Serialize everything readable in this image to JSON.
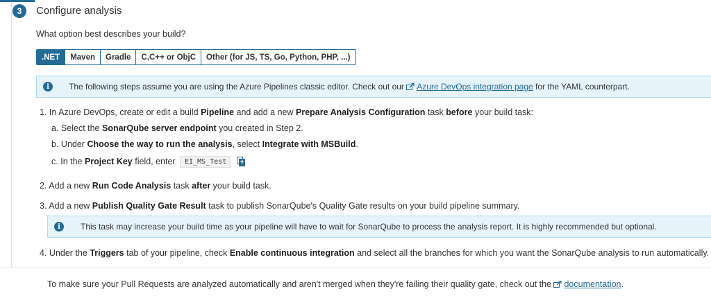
{
  "step": {
    "number": "3",
    "title": "Configure analysis"
  },
  "question": "What option best describes your build?",
  "build_options": [
    ".NET",
    "Maven",
    "Gradle",
    "C,C++ or ObjC",
    "Other (for JS, TS, Go, Python, PHP, ...)"
  ],
  "selected_option": ".NET",
  "info1": {
    "text_before": "The following steps assume you are using the Azure Pipelines classic editor. Check out our ",
    "link": "Azure DevOps integration page",
    "text_after": " for the YAML counterpart."
  },
  "steps": {
    "s1": {
      "n": "1.",
      "t1": "In Azure DevOps, create or edit a build ",
      "b1": "Pipeline",
      "t2": " and add a new ",
      "b2": "Prepare Analysis Configuration",
      "t3": " task ",
      "b3": "before",
      "t4": " your build task:"
    },
    "s1a": {
      "n": "a.",
      "t1": "Select the ",
      "b1": "SonarQube server endpoint",
      "t2": " you created in Step 2."
    },
    "s1b": {
      "n": "b.",
      "t1": "Under ",
      "b1": "Choose the way to run the analysis",
      "t2": ", select ",
      "b2": "Integrate with MSBuild",
      "t3": "."
    },
    "s1c": {
      "n": "c.",
      "t1": "In the ",
      "b1": "Project Key",
      "t2": " field, enter ",
      "code": "EI_MS_Test"
    },
    "s2": {
      "n": "2.",
      "t1": "Add a new ",
      "b1": "Run Code Analysis",
      "t2": " task ",
      "b2": "after",
      "t3": " your build task."
    },
    "s3": {
      "n": "3.",
      "t1": "Add a new ",
      "b1": "Publish Quality Gate Result",
      "t2": " task to publish SonarQube's Quality Gate results on your build pipeline summary."
    },
    "s4": {
      "n": "4.",
      "t1": "Under the ",
      "b1": "Triggers",
      "t2": " tab of your pipeline, check ",
      "b2": "Enable continuous integration",
      "t3": " and select all the branches for which you want the SonarQube analysis to run automatically."
    }
  },
  "info2": {
    "text": "This task may increase your build time as your pipeline will have to wait for SonarQube to process the analysis report. It is highly recommended but optional."
  },
  "footer": {
    "text_before": "To make sure your Pull Requests are analyzed automatically and aren't merged when they're failing their quality gate, check out the ",
    "link": "documentation",
    "text_after": "."
  },
  "icons": {
    "info": "info-icon",
    "external": "external-link-icon",
    "copy": "copy-icon"
  },
  "colors": {
    "accent": "#236a97",
    "info_bg": "#e6f3fb",
    "info_border": "#b3d9ef"
  }
}
